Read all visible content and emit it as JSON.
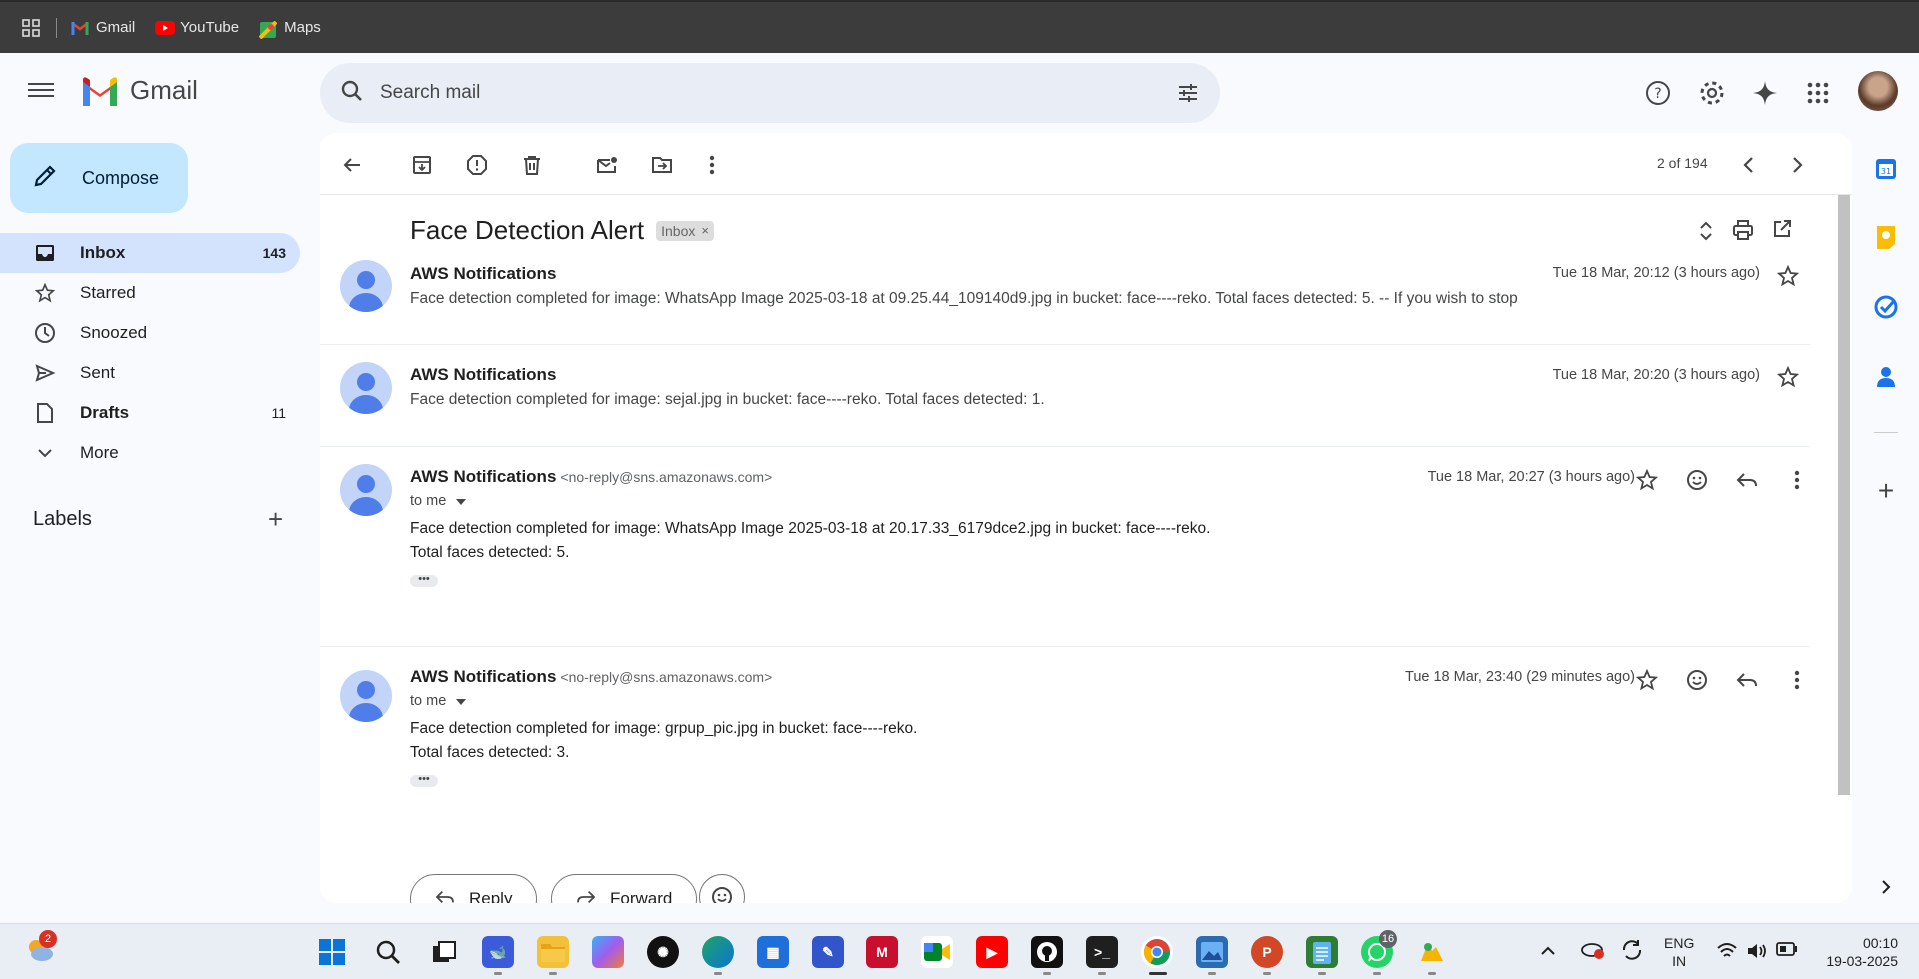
{
  "bookmarks": [
    {
      "label": "Gmail",
      "icon": "gmail-icon"
    },
    {
      "label": "YouTube",
      "icon": "youtube-icon"
    },
    {
      "label": "Maps",
      "icon": "maps-icon"
    }
  ],
  "header": {
    "app_name": "Gmail",
    "search_placeholder": "Search mail"
  },
  "sidebar": {
    "compose_label": "Compose",
    "items": [
      {
        "label": "Inbox",
        "count": "143"
      },
      {
        "label": "Starred",
        "count": ""
      },
      {
        "label": "Snoozed",
        "count": ""
      },
      {
        "label": "Sent",
        "count": ""
      },
      {
        "label": "Drafts",
        "count": "11"
      },
      {
        "label": "More",
        "count": ""
      }
    ],
    "labels_heading": "Labels"
  },
  "toolbar": {
    "pager": "2 of 194"
  },
  "thread": {
    "subject": "Face Detection Alert",
    "chip": "Inbox",
    "messages": [
      {
        "sender": "AWS Notifications",
        "email": "",
        "date": "Tue 18 Mar, 20:12 (3 hours ago)",
        "snippet": "Face detection completed for image: WhatsApp Image 2025-03-18 at 09.25.44_109140d9.jpg in bucket: face----reko. Total faces detected: 5. -- If you wish to stop"
      },
      {
        "sender": "AWS Notifications",
        "email": "",
        "date": "Tue 18 Mar, 20:20 (3 hours ago)",
        "snippet": "Face detection completed for image: sejal.jpg in bucket: face----reko. Total faces detected: 1."
      },
      {
        "sender": "AWS Notifications",
        "email": "<no-reply@sns.amazonaws.com>",
        "date": "Tue 18 Mar, 20:27 (3 hours ago)",
        "to": "to me",
        "body_line1": "Face detection completed for image: WhatsApp Image 2025-03-18 at 20.17.33_6179dce2.jpg in bucket: face----reko.",
        "body_line2": "Total faces detected: 5."
      },
      {
        "sender": "AWS Notifications",
        "email": "<no-reply@sns.amazonaws.com>",
        "date": "Tue 18 Mar, 23:40 (29 minutes ago)",
        "to": "to me",
        "body_line1": "Face detection completed for image: grpup_pic.jpg in bucket: face----reko.",
        "body_line2": "Total faces detected: 3."
      }
    ],
    "reply_label": "Reply",
    "forward_label": "Forward"
  },
  "taskbar": {
    "weather_badge": "2",
    "whatsapp_badge": "16",
    "lang_line1": "ENG",
    "lang_line2": "IN",
    "time": "00:10",
    "date": "19-03-2025"
  },
  "colors": {
    "accent": "#c2e7ff",
    "active_nav": "#d3e3fd",
    "avatar": "#4f7ee8"
  }
}
